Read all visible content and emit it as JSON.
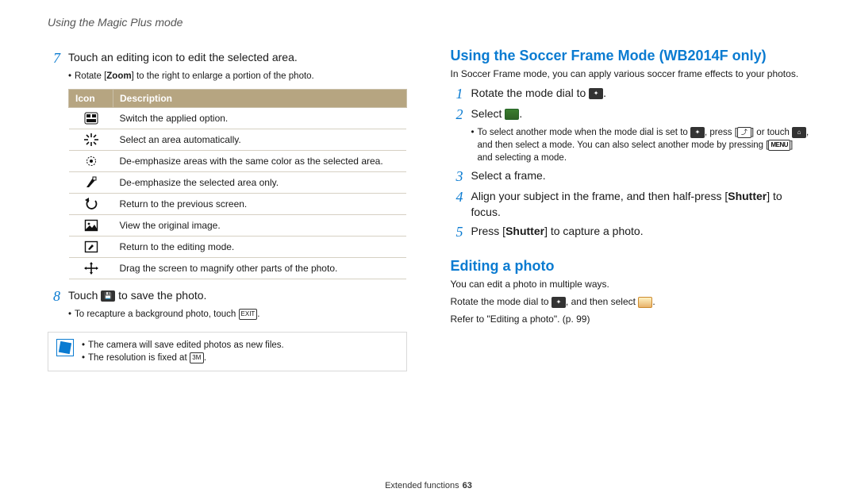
{
  "page_header": "Using the Magic Plus mode",
  "left": {
    "step7_num": "7",
    "step7_text": "Touch an editing icon to edit the selected area.",
    "step7_bullet_prefix": "Rotate [",
    "step7_bullet_bold": "Zoom",
    "step7_bullet_suffix": "] to the right to enlarge a portion of the photo.",
    "table_head_icon": "Icon",
    "table_head_desc": "Description",
    "rows": [
      {
        "icon_name": "switch-option-icon",
        "desc": "Switch the applied option."
      },
      {
        "icon_name": "auto-select-icon",
        "desc": "Select an area automatically."
      },
      {
        "icon_name": "deemphasize-color-icon",
        "desc": "De-emphasize areas with the same color as the selected area."
      },
      {
        "icon_name": "deemphasize-area-icon",
        "desc": "De-emphasize the selected area only."
      },
      {
        "icon_name": "return-previous-icon",
        "desc": "Return to the previous screen."
      },
      {
        "icon_name": "view-original-icon",
        "desc": "View the original image."
      },
      {
        "icon_name": "return-edit-icon",
        "desc": "Return to the editing mode."
      },
      {
        "icon_name": "drag-magnify-icon",
        "desc": "Drag the screen to magnify other parts of the photo."
      }
    ],
    "step8_num": "8",
    "step8_prefix": "Touch ",
    "step8_icon_label": "💾",
    "step8_suffix": " to save the photo.",
    "step8_bullet_prefix": "To recapture a background photo, touch ",
    "step8_bullet_chip": "EXIT",
    "step8_bullet_suffix": ".",
    "note1": "The camera will save edited photos as new files.",
    "note2_prefix": "The resolution is fixed at ",
    "note2_chip": "3M",
    "note2_suffix": "."
  },
  "right": {
    "soccer_title": "Using the Soccer Frame Mode (WB2014F only)",
    "soccer_intro": "In Soccer Frame mode, you can apply various soccer frame effects to your photos.",
    "s1_num": "1",
    "s1_prefix": "Rotate the mode dial to ",
    "s1_suffix": ".",
    "s2_num": "2",
    "s2_prefix": "Select ",
    "s2_suffix": ".",
    "s2b_prefix": "To select another mode when the mode dial is set to ",
    "s2b_mid1": ", press [",
    "s2b_mid2": "] or touch ",
    "s2b_mid3": ", and then select a mode. You can also select another mode by pressing [",
    "s2b_menu": "MENU",
    "s2b_mid4": "] and selecting a mode.",
    "s3_num": "3",
    "s3_text": "Select a frame.",
    "s4_num": "4",
    "s4_prefix": "Align your subject in the frame, and then half-press [",
    "s4_bold": "Shutter",
    "s4_suffix": "] to focus.",
    "s5_num": "5",
    "s5_prefix": "Press [",
    "s5_bold": "Shutter",
    "s5_suffix": "] to capture a photo.",
    "edit_title": "Editing a photo",
    "edit_line1": "You can edit a photo in multiple ways.",
    "edit_line2_prefix": "Rotate the mode dial to ",
    "edit_line2_mid": ", and then select ",
    "edit_line2_suffix": ".",
    "edit_line3": "Refer to \"Editing a photo\". (p. 99)"
  },
  "footer_label": "Extended functions",
  "footer_page": "63",
  "chart_data": {
    "type": "table",
    "title": "Editing icon reference",
    "columns": [
      "Icon",
      "Description"
    ],
    "rows": [
      [
        "switch-option-icon",
        "Switch the applied option."
      ],
      [
        "auto-select-icon",
        "Select an area automatically."
      ],
      [
        "deemphasize-color-icon",
        "De-emphasize areas with the same color as the selected area."
      ],
      [
        "deemphasize-area-icon",
        "De-emphasize the selected area only."
      ],
      [
        "return-previous-icon",
        "Return to the previous screen."
      ],
      [
        "view-original-icon",
        "View the original image."
      ],
      [
        "return-edit-icon",
        "Return to the editing mode."
      ],
      [
        "drag-magnify-icon",
        "Drag the screen to magnify other parts of the photo."
      ]
    ]
  }
}
